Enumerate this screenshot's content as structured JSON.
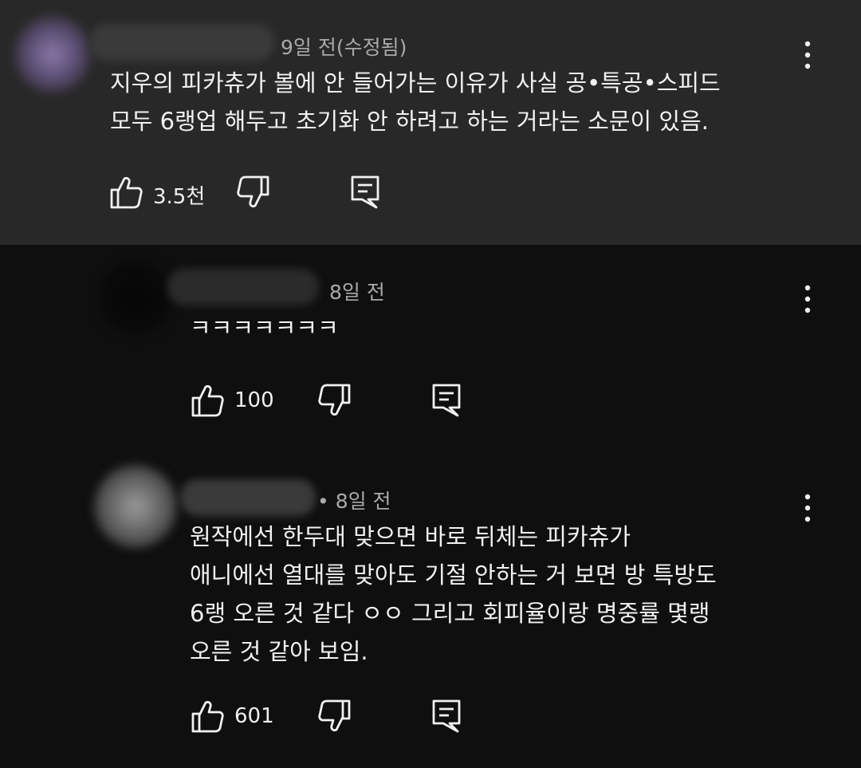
{
  "comments": [
    {
      "time": "9일 전(수정됨)",
      "lines": [
        "지우의 피카츄가 볼에 안 들어가는 이유가 사실 공•특공•스피드",
        "모두 6랭업 해두고 초기화 안 하려고 하는 거라는 소문이 있음."
      ],
      "likes": "3.5천"
    },
    {
      "time": "8일 전",
      "lines": [
        "ㅋㅋㅋㅋㅋㅋㅋ"
      ],
      "likes": "100"
    },
    {
      "time": "• 8일 전",
      "lines": [
        "원작에선 한두대 맞으면 바로 뒤체는 피카츄가",
        "애니에선 열대를 맞아도 기절 안하는 거 보면 방 특방도",
        "6랭 오른 것 같다 ㅇㅇ 그리고 회피율이랑 명중률 몇랭",
        "오른 것 같아 보임."
      ],
      "likes": "601"
    }
  ],
  "icons": {
    "like": "thumbs-up-icon",
    "dislike": "thumbs-down-icon",
    "reply": "reply-comment-icon",
    "more": "more-vertical-icon"
  },
  "colors": {
    "background": "#0f0f0f",
    "highlight_background": "#282828",
    "text": "#f1f1f1",
    "meta": "#aaaaaa"
  }
}
